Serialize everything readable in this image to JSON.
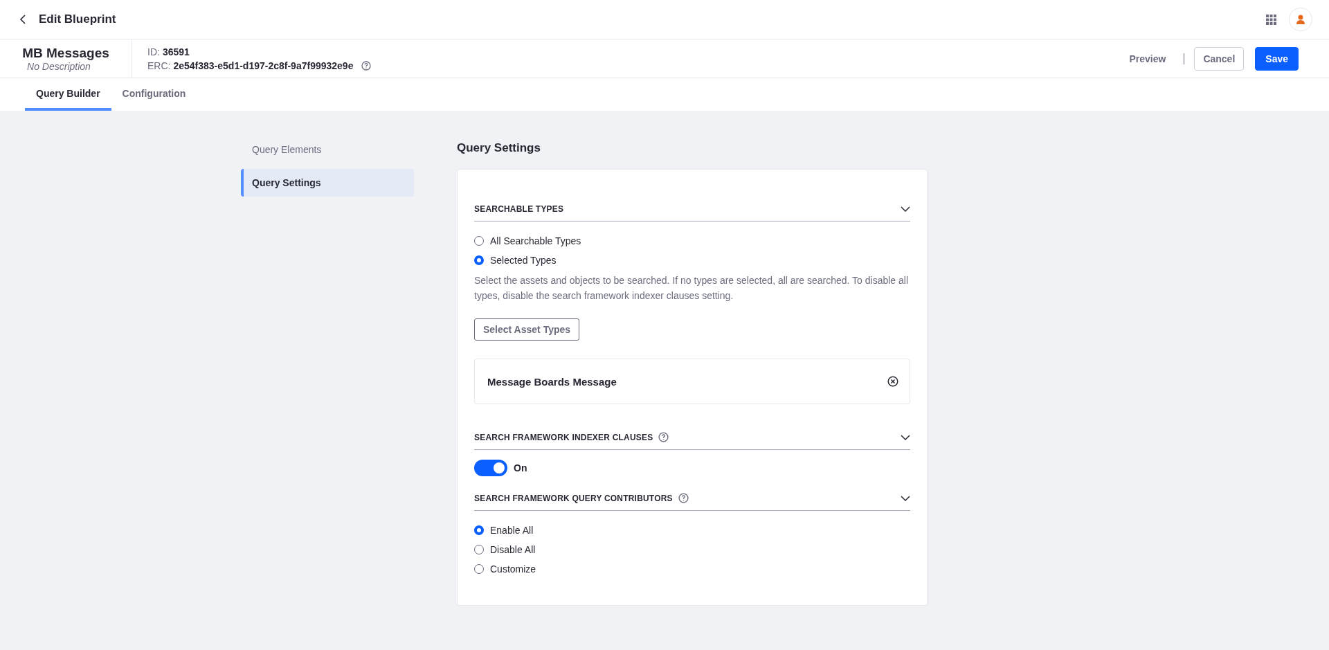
{
  "topbar": {
    "title": "Edit Blueprint"
  },
  "info": {
    "name": "MB Messages",
    "description": "No Description",
    "id_label": "ID:",
    "id": "36591",
    "erc_label": "ERC:",
    "erc": "2e54f383-e5d1-d197-2c8f-9a7f99932e9e"
  },
  "actions": {
    "preview": "Preview",
    "cancel": "Cancel",
    "save": "Save"
  },
  "tabs": [
    {
      "label": "Query Builder",
      "selected": true
    },
    {
      "label": "Configuration",
      "selected": false
    }
  ],
  "sidebar": {
    "items": [
      {
        "label": "Query Elements",
        "selected": false
      },
      {
        "label": "Query Settings",
        "selected": true
      }
    ]
  },
  "page_title": "Query Settings",
  "sections": [
    {
      "kind": "radio",
      "title": "SEARCHABLE TYPES",
      "help": false,
      "options": [
        {
          "label": "All Searchable Types",
          "selected": false
        },
        {
          "label": "Selected Types",
          "selected": true
        }
      ],
      "description": "Select the assets and objects to be searched. If no types are selected, all are searched. To disable all types, disable the search framework indexer clauses setting.",
      "button": "Select Asset Types",
      "items": [
        "Message Boards Message"
      ]
    },
    {
      "kind": "toggle",
      "title": "SEARCH FRAMEWORK INDEXER CLAUSES",
      "help": true,
      "on": true,
      "toggle_label": "On"
    },
    {
      "kind": "radio",
      "title": "SEARCH FRAMEWORK QUERY CONTRIBUTORS",
      "help": true,
      "options": [
        {
          "label": "Enable All",
          "selected": true
        },
        {
          "label": "Disable All",
          "selected": false
        },
        {
          "label": "Customize",
          "selected": false
        }
      ]
    }
  ]
}
